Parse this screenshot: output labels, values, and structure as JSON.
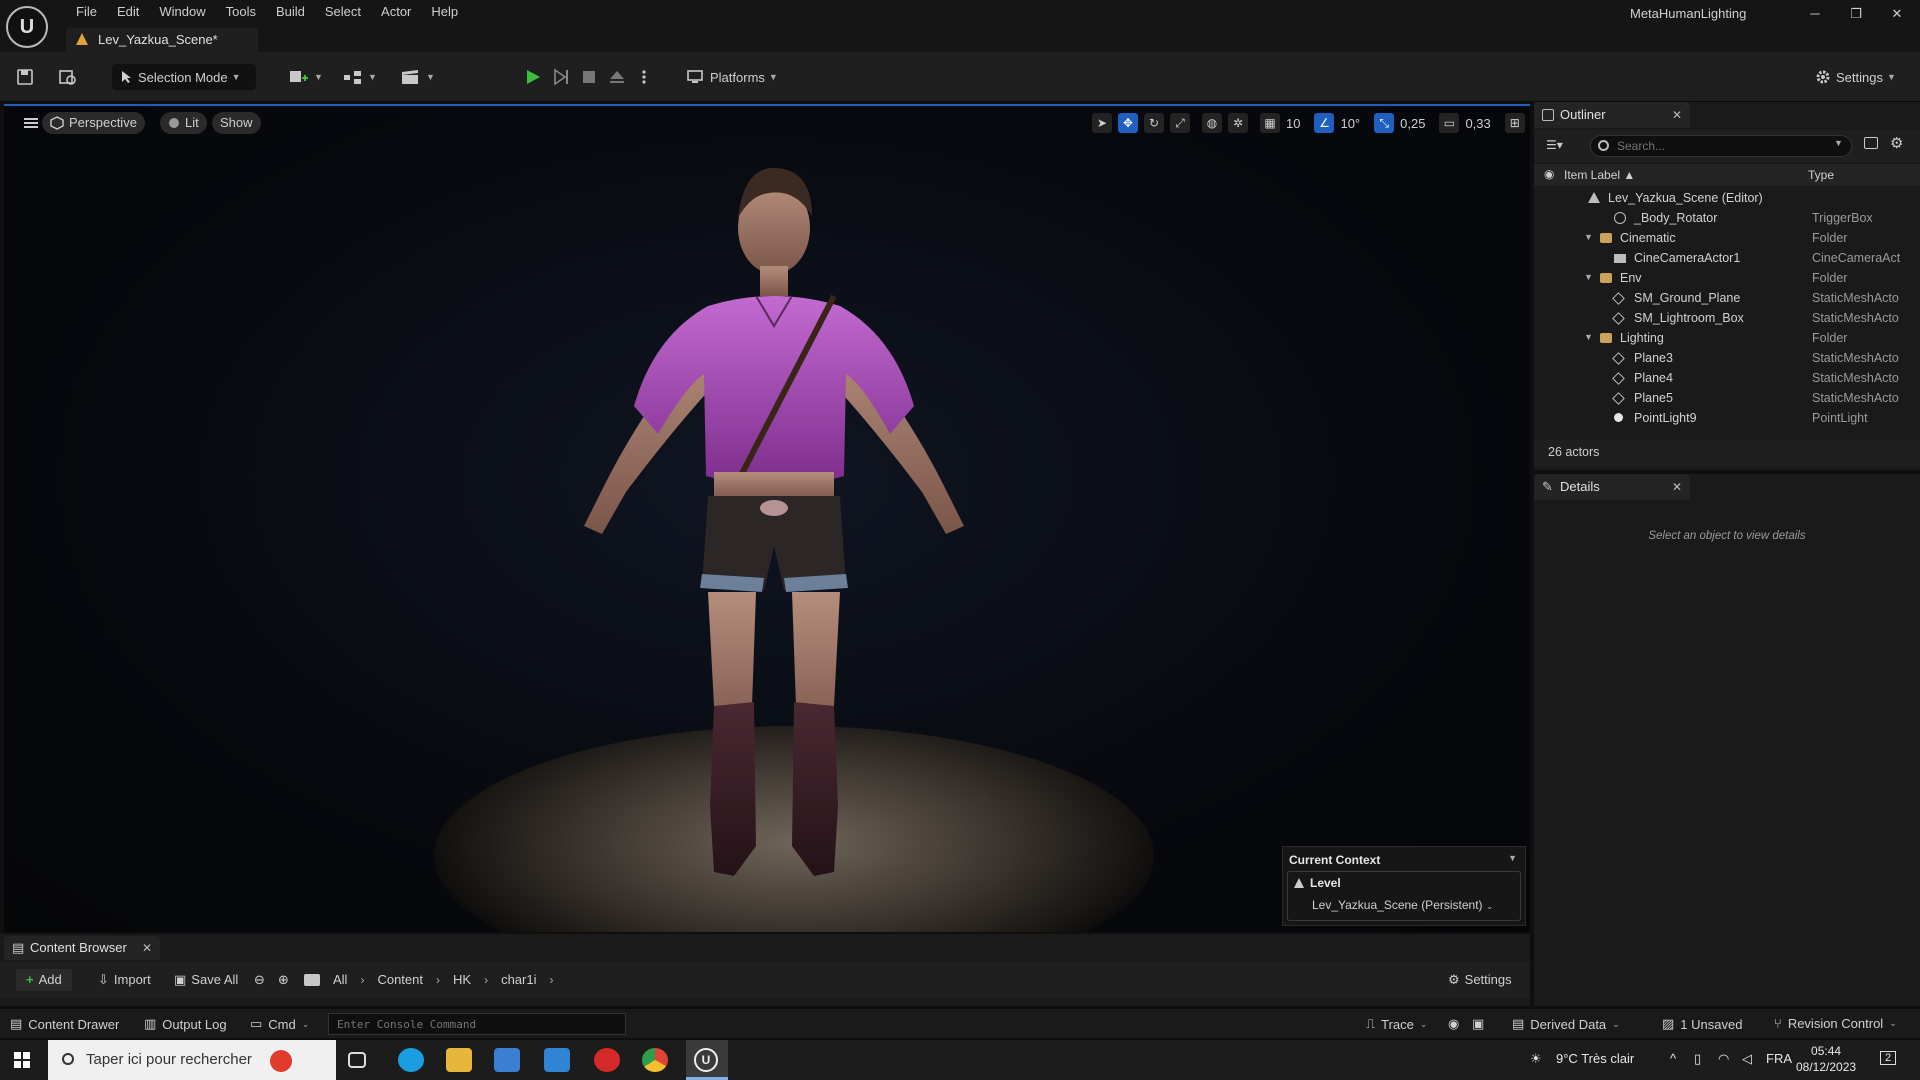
{
  "window": {
    "project_name": "MetaHumanLighting",
    "level_tab": "Lev_Yazkua_Scene*",
    "min_glyph": "─",
    "restore_glyph": "❐",
    "close_glyph": "✕"
  },
  "menu": [
    "File",
    "Edit",
    "Window",
    "Tools",
    "Build",
    "Select",
    "Actor",
    "Help"
  ],
  "toolbar": {
    "selection_mode": "Selection Mode",
    "platforms": "Platforms",
    "settings": "Settings"
  },
  "viewport": {
    "perspective": "Perspective",
    "lit": "Lit",
    "show": "Show",
    "grid_snap": "10",
    "rotation_snap": "10°",
    "scale_snap": "0,25",
    "camera_speed": "0,33"
  },
  "current_context": {
    "title": "Current Context",
    "level_label": "Level",
    "level_value": "Lev_Yazkua_Scene (Persistent)"
  },
  "outliner": {
    "tab": "Outliner",
    "search_placeholder": "Search...",
    "col_label": "Item Label ▲",
    "col_type": "Type",
    "rows": [
      {
        "name": "Lev_Yazkua_Scene (Editor)",
        "type": "",
        "icon": "level-icon"
      },
      {
        "name": "_Body_Rotator",
        "type": "TriggerBox",
        "icon": "trigger-icon"
      },
      {
        "name": "Cinematic",
        "type": "Folder",
        "icon": "folder-icon"
      },
      {
        "name": "CineCameraActor1",
        "type": "CineCameraAct",
        "icon": "camera-icon"
      },
      {
        "name": "Env",
        "type": "Folder",
        "icon": "folder-icon"
      },
      {
        "name": "SM_Ground_Plane",
        "type": "StaticMeshActo",
        "icon": "mesh-icon"
      },
      {
        "name": "SM_Lightroom_Box",
        "type": "StaticMeshActo",
        "icon": "mesh-icon"
      },
      {
        "name": "Lighting",
        "type": "Folder",
        "icon": "folder-icon"
      },
      {
        "name": "Plane3",
        "type": "StaticMeshActo",
        "icon": "mesh-icon"
      },
      {
        "name": "Plane4",
        "type": "StaticMeshActo",
        "icon": "mesh-icon"
      },
      {
        "name": "Plane5",
        "type": "StaticMeshActo",
        "icon": "mesh-icon"
      },
      {
        "name": "PointLight9",
        "type": "PointLight",
        "icon": "light-icon"
      }
    ],
    "actor_count": "26 actors"
  },
  "details": {
    "tab": "Details",
    "empty_message": "Select an object to view details"
  },
  "content_browser": {
    "tab": "Content Browser",
    "add": "Add",
    "import": "Import",
    "save_all": "Save All",
    "breadcrumb": [
      "All",
      "Content",
      "HK",
      "char1i"
    ],
    "settings": "Settings"
  },
  "statusbar": {
    "content_drawer": "Content Drawer",
    "output_log": "Output Log",
    "cmd": "Cmd",
    "console_placeholder": "Enter Console Command",
    "trace": "Trace",
    "derived_data": "Derived Data",
    "unsaved": "1 Unsaved",
    "revision_control": "Revision Control"
  },
  "taskbar": {
    "search_placeholder": "Taper ici pour rechercher",
    "weather": "9°C  Très clair",
    "language": "FRA",
    "time": "05:44",
    "date": "08/12/2023",
    "notifications": "2"
  }
}
